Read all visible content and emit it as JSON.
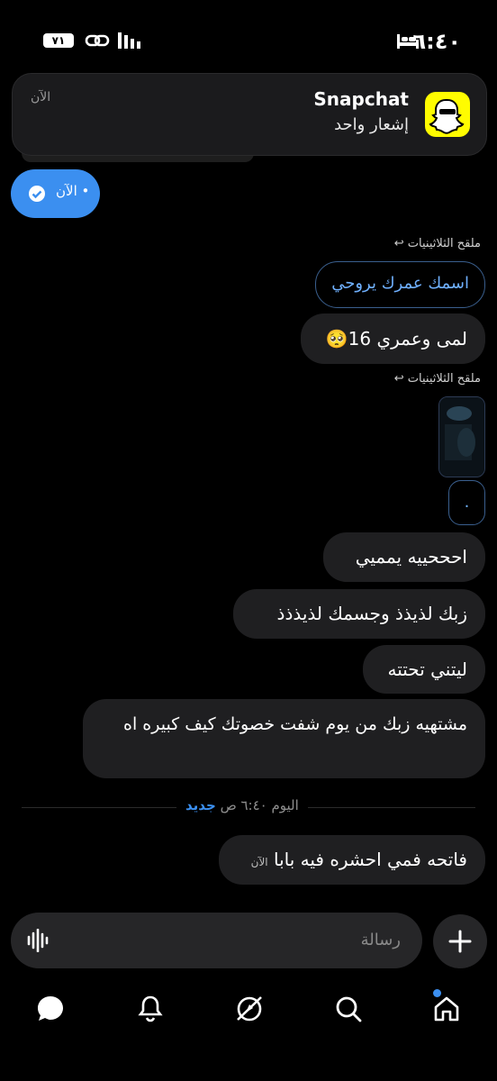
{
  "status_bar": {
    "time": "٦:٤٠",
    "battery": "٧١"
  },
  "notification": {
    "app": "Snapchat",
    "body": "إشعار واحد",
    "time": "الآن"
  },
  "sent_status": {
    "label": "• الآن"
  },
  "messages": [
    {
      "reply_to": "ملقح الثلاثينيات",
      "quote": "اسمك عمرك يروحي"
    },
    {
      "text": "لمى وعمري 16🥺"
    },
    {
      "reply_to": "ملقح الثلاثينيات",
      "dot": "."
    },
    {
      "text": "احححييه يمميي"
    },
    {
      "text": "زبك لذيذذ وجسمك لذيذذذ"
    },
    {
      "text": "ليتني تحتته"
    },
    {
      "text": "مشتهيه زبك من يوم شفت خصوتك كيف كبيره اه"
    },
    {
      "text": "فاتحه فمي احشره فيه بابا",
      "time": "الآن"
    }
  ],
  "divider": {
    "label": "اليوم ٦:٤٠ ص",
    "new": "جديد"
  },
  "composer": {
    "placeholder": "رسالة"
  },
  "nav": [
    "messages-icon",
    "notifications-icon",
    "explore-icon",
    "search-icon",
    "home-icon"
  ]
}
